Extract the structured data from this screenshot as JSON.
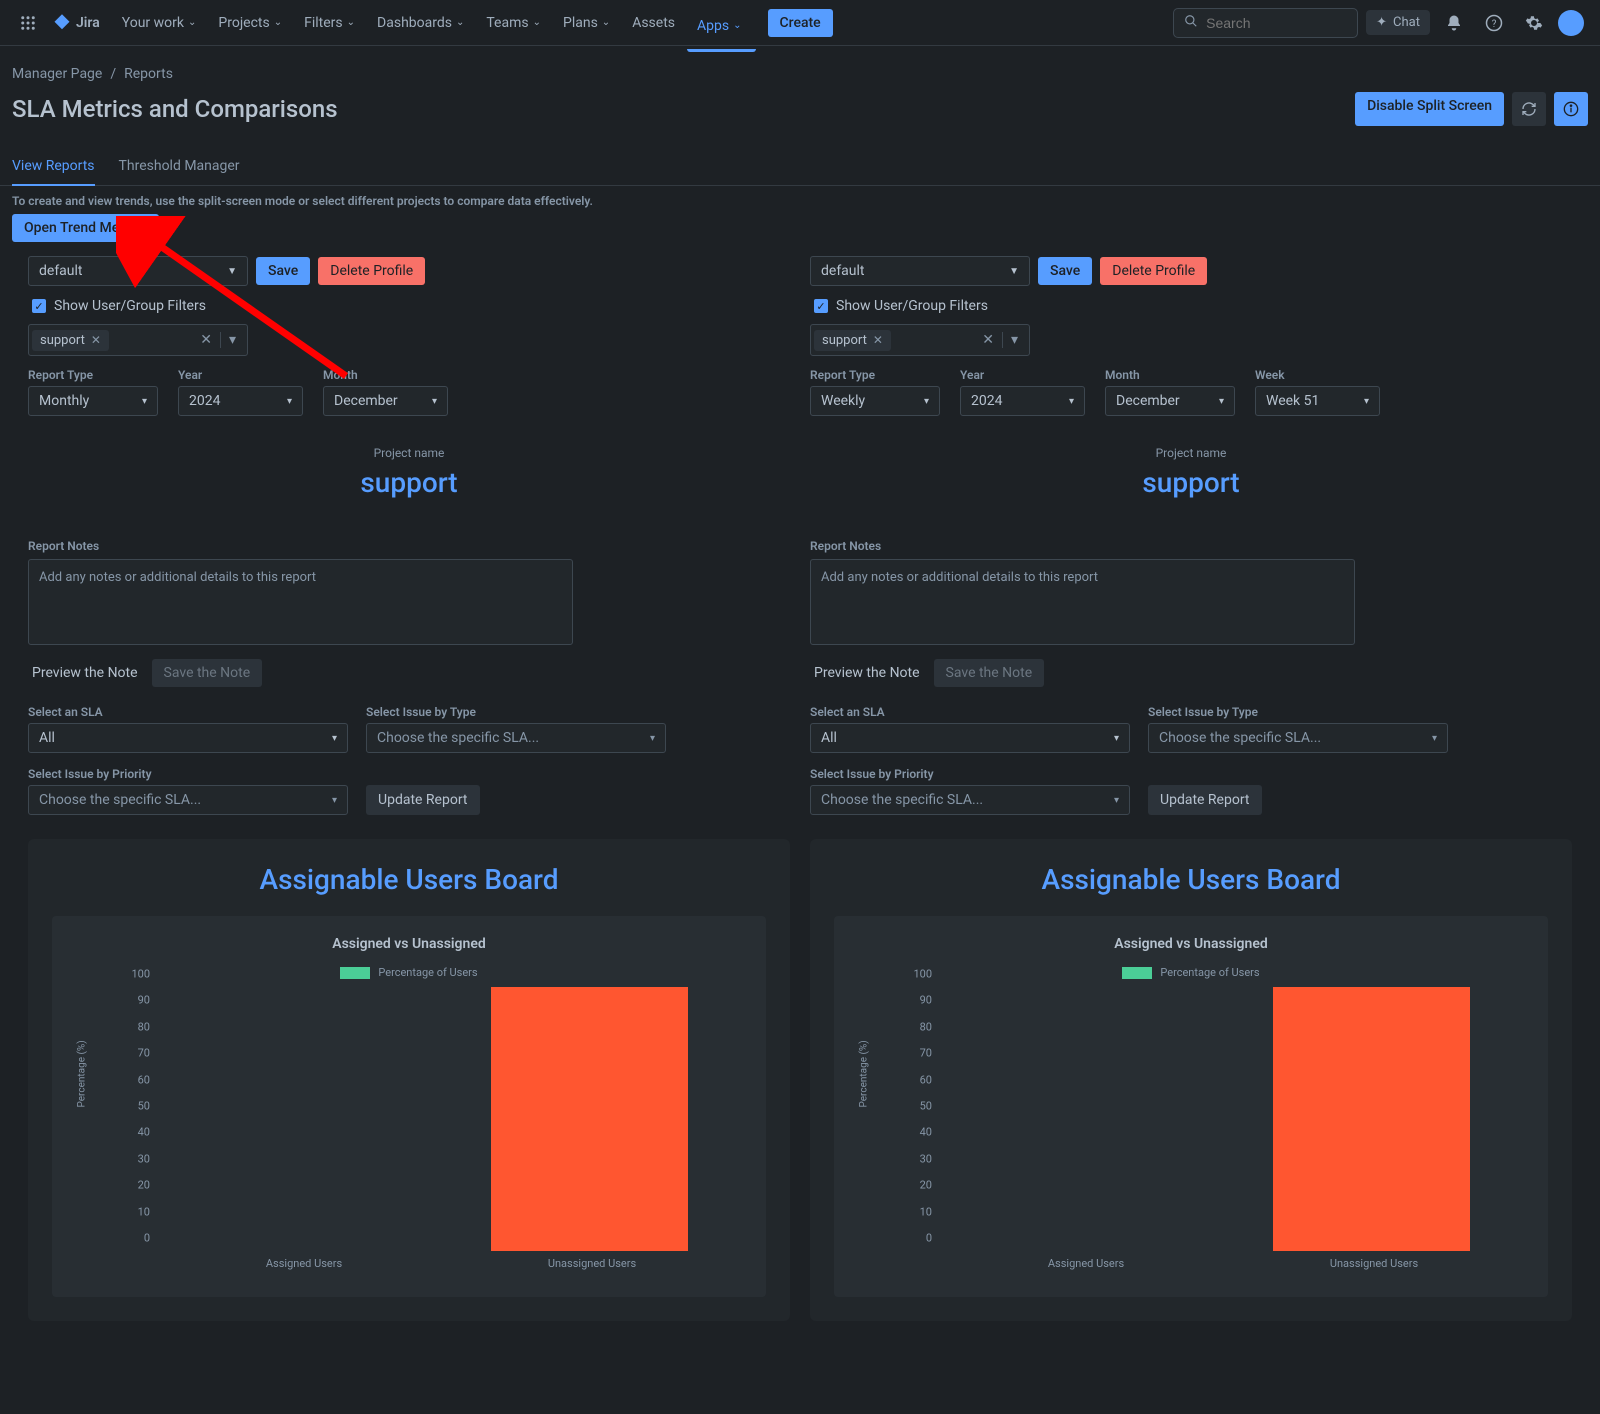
{
  "nav": {
    "logo": "Jira",
    "items": [
      "Your work",
      "Projects",
      "Filters",
      "Dashboards",
      "Teams",
      "Plans",
      "Assets",
      "Apps"
    ],
    "activeIndex": 7,
    "create": "Create",
    "searchPlaceholder": "Search",
    "chat": "Chat"
  },
  "breadcrumb": {
    "a": "Manager Page",
    "b": "Reports"
  },
  "page": {
    "title": "SLA Metrics and Comparisons",
    "disableSplit": "Disable Split Screen"
  },
  "tabs": {
    "view": "View Reports",
    "threshold": "Threshold Manager"
  },
  "hint": "To create and view trends, use the split-screen mode or select different projects to compare data effectively.",
  "openTrend": "Open Trend Metrics",
  "panelLeft": {
    "profile": "default",
    "save": "Save",
    "delete": "Delete Profile",
    "showFilters": "Show User/Group Filters",
    "tag": "support",
    "reportTypeLabel": "Report Type",
    "reportType": "Monthly",
    "yearLabel": "Year",
    "year": "2024",
    "monthLabel": "Month",
    "month": "December",
    "projectLabel": "Project name",
    "projectName": "support",
    "notesLabel": "Report Notes",
    "notesPlaceholder": "Add any notes or additional details to this report",
    "preview": "Preview the Note",
    "saveNote": "Save the Note",
    "slaLabel": "Select an SLA",
    "sla": "All",
    "issueTypeLabel": "Select Issue by Type",
    "issueType": "Choose the specific SLA...",
    "priorityLabel": "Select Issue by Priority",
    "priority": "Choose the specific SLA...",
    "update": "Update Report",
    "chartTitle": "Assignable Users Board",
    "chartSub": "Assigned vs Unassigned",
    "legend": "Percentage of Users",
    "ylabel": "Percentage (%)",
    "xAssigned": "Assigned Users",
    "xUnassigned": "Unassigned Users"
  },
  "panelRight": {
    "profile": "default",
    "save": "Save",
    "delete": "Delete Profile",
    "showFilters": "Show User/Group Filters",
    "tag": "support",
    "reportTypeLabel": "Report Type",
    "reportType": "Weekly",
    "yearLabel": "Year",
    "year": "2024",
    "monthLabel": "Month",
    "month": "December",
    "weekLabel": "Week",
    "week": "Week 51",
    "projectLabel": "Project name",
    "projectName": "support",
    "notesLabel": "Report Notes",
    "notesPlaceholder": "Add any notes or additional details to this report",
    "preview": "Preview the Note",
    "saveNote": "Save the Note",
    "slaLabel": "Select an SLA",
    "sla": "All",
    "issueTypeLabel": "Select Issue by Type",
    "issueType": "Choose the specific SLA...",
    "priorityLabel": "Select Issue by Priority",
    "priority": "Choose the specific SLA...",
    "update": "Update Report",
    "chartTitle": "Assignable Users Board",
    "chartSub": "Assigned vs Unassigned",
    "legend": "Percentage of Users",
    "ylabel": "Percentage (%)",
    "xAssigned": "Assigned Users",
    "xUnassigned": "Unassigned Users"
  },
  "chart_data": [
    {
      "type": "bar",
      "title": "Assigned vs Unassigned",
      "categories": [
        "Assigned Users",
        "Unassigned Users"
      ],
      "series": [
        {
          "name": "Percentage of Users",
          "values": [
            0,
            100
          ]
        }
      ],
      "ylabel": "Percentage (%)",
      "ylim": [
        0,
        100
      ],
      "yticks": [
        0,
        10,
        20,
        30,
        40,
        50,
        60,
        70,
        80,
        90,
        100
      ]
    },
    {
      "type": "bar",
      "title": "Assigned vs Unassigned",
      "categories": [
        "Assigned Users",
        "Unassigned Users"
      ],
      "series": [
        {
          "name": "Percentage of Users",
          "values": [
            0,
            100
          ]
        }
      ],
      "ylabel": "Percentage (%)",
      "ylim": [
        0,
        100
      ],
      "yticks": [
        0,
        10,
        20,
        30,
        40,
        50,
        60,
        70,
        80,
        90,
        100
      ]
    }
  ]
}
